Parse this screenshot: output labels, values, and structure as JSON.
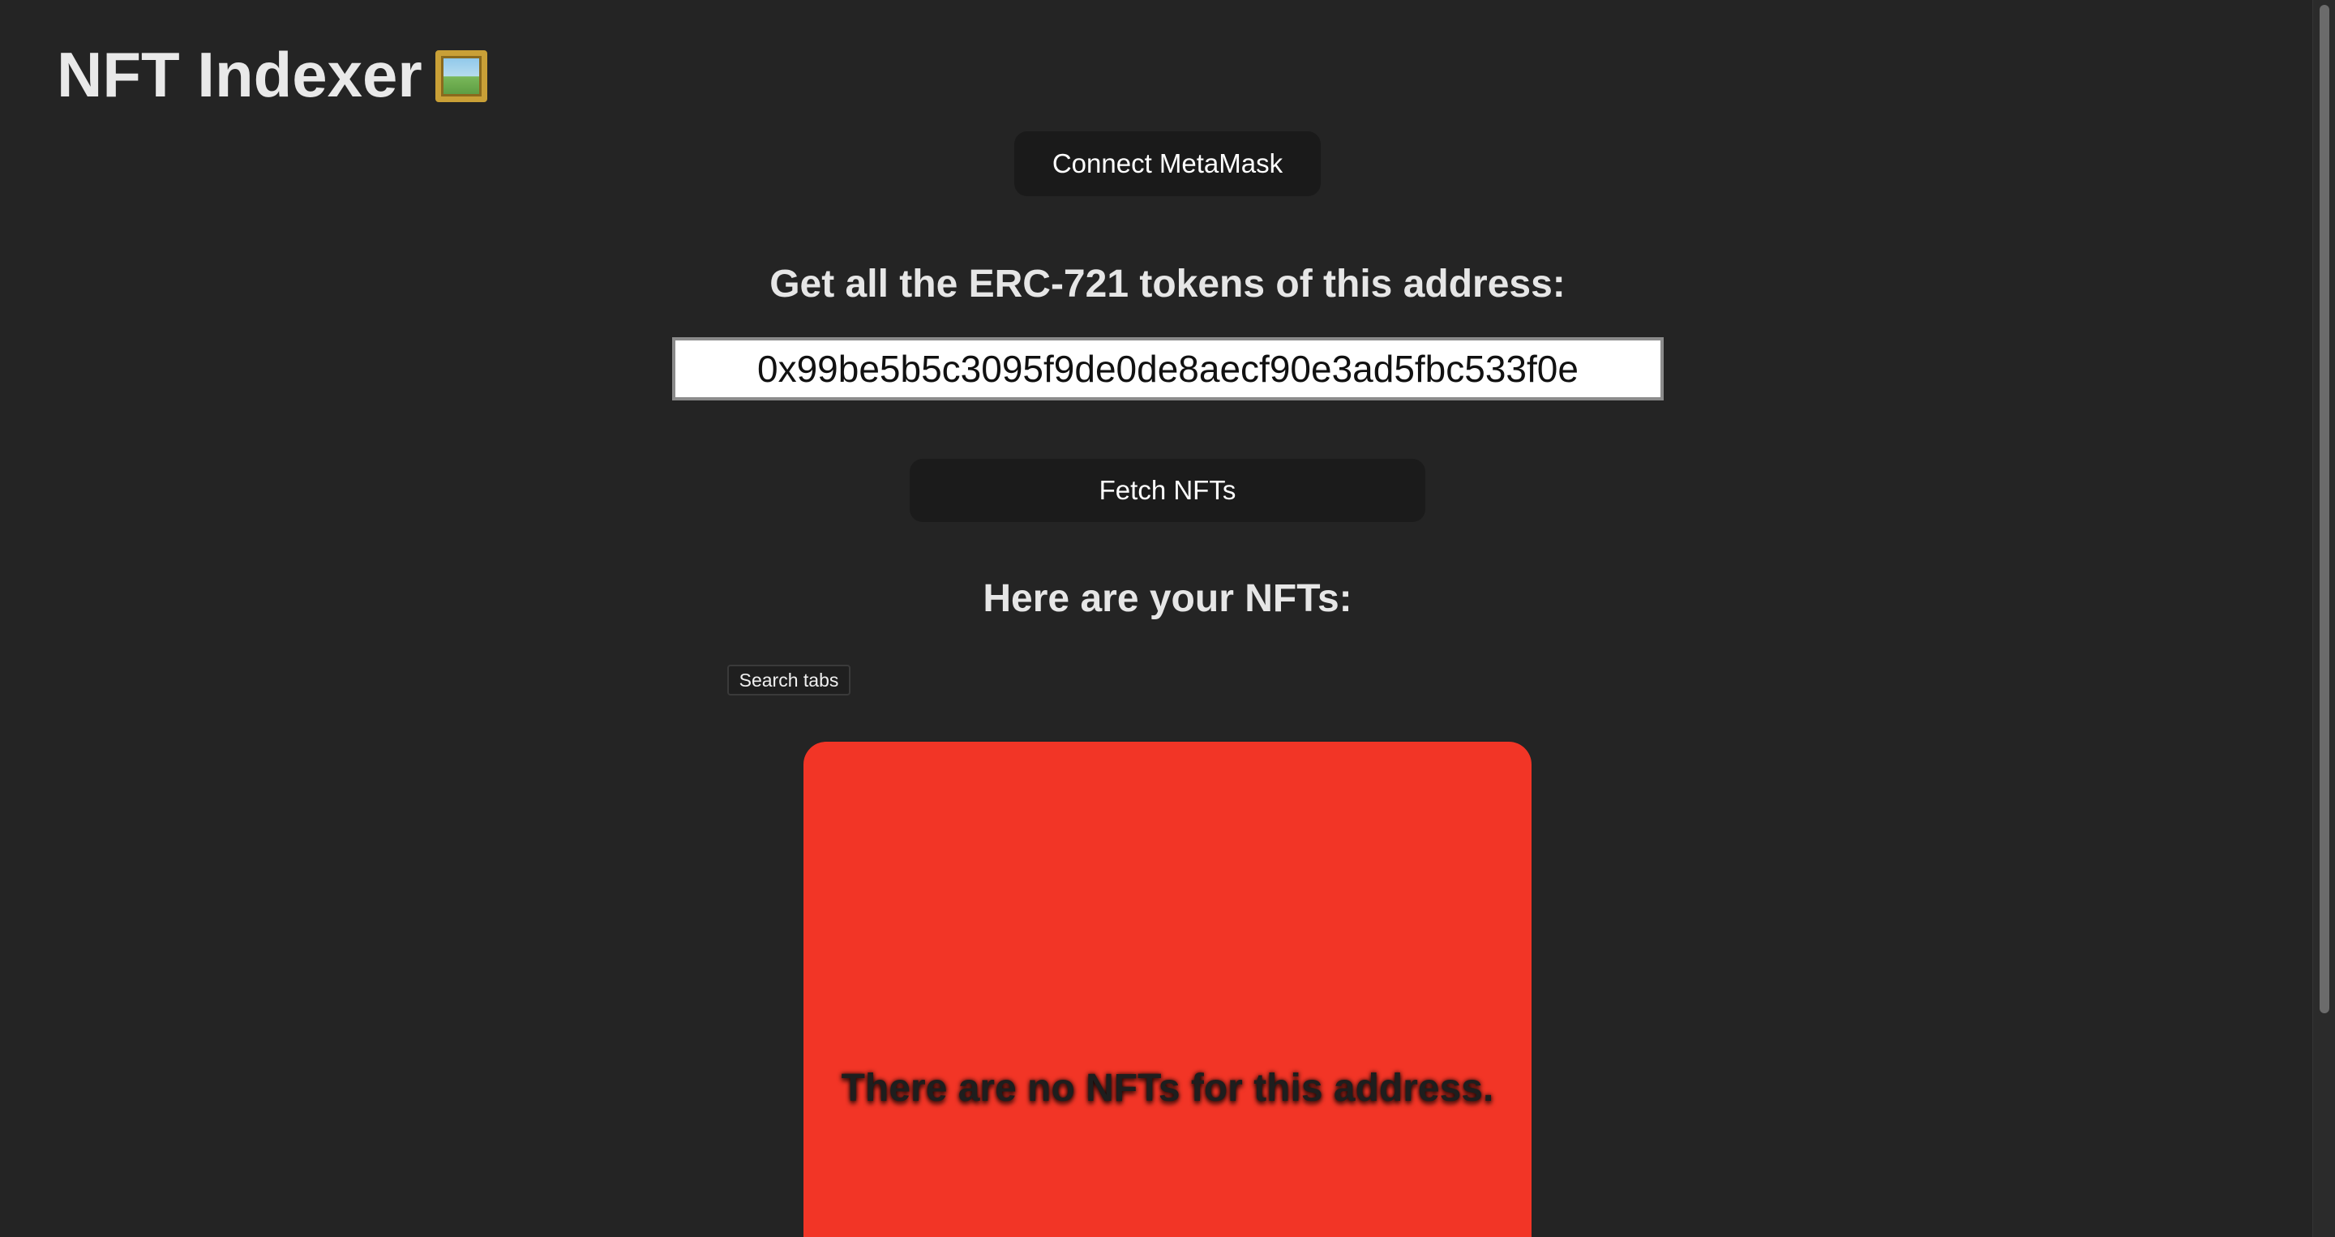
{
  "header": {
    "title": "NFT Indexer",
    "title_icon": "framed-picture-icon"
  },
  "wallet": {
    "connect_label": "Connect MetaMask"
  },
  "lookup": {
    "heading": "Get all the ERC-721 tokens of this address:",
    "address_value": "0x99be5b5c3095f9de0de8aecf90e3ad5fbc533f0e",
    "fetch_label": "Fetch NFTs"
  },
  "results": {
    "heading": "Here are your NFTs:",
    "search_tabs_label": "Search tabs",
    "empty_message": "There are no NFTs for this address.",
    "empty_card_color": "#f23526"
  },
  "colors": {
    "background": "#242424",
    "button": "#1a1a1a",
    "text": "#e6e6e6"
  }
}
